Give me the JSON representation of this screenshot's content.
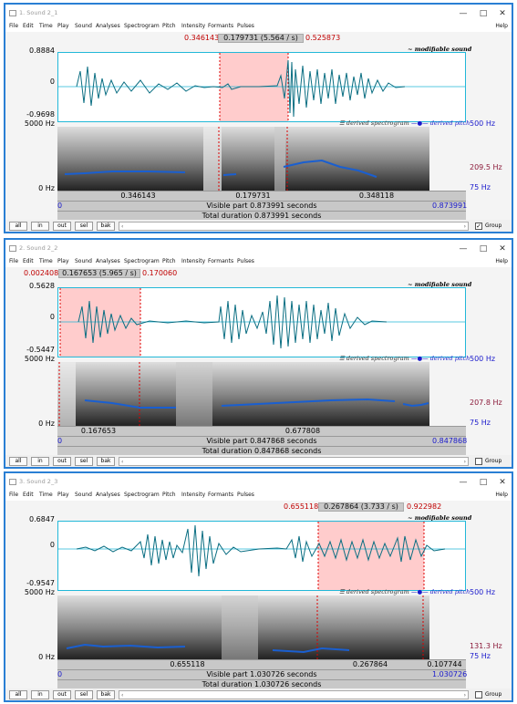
{
  "menu": [
    "File",
    "Edit",
    "Time",
    "Play",
    "Sound",
    "Analyses",
    "Spectrogram",
    "Pitch",
    "Intensity",
    "Formants",
    "Pulses"
  ],
  "help": "Help",
  "legend_modifiable": "~ modifiable sound",
  "legend_spectrogram": "derived spectrogram",
  "legend_pitch": "derived pitch",
  "buttons": [
    "all",
    "in",
    "out",
    "sel",
    "bak"
  ],
  "group_label": "Group",
  "windows": [
    {
      "title": "1. Sound 2_1",
      "sel_left": "0.346143",
      "sel_center": "0.179731 (5.564 / s)",
      "sel_right": "0.525873",
      "y_max": "0.8884",
      "y_zero": "0",
      "y_min": "-0.9698",
      "spec_top": "5000 Hz",
      "spec_bottom": "0 Hz",
      "pitch_top": "500 Hz",
      "pitch_value": "209.5 Hz",
      "pitch_bottom": "75 Hz",
      "seg1": "0.346143",
      "seg2": "0.179731",
      "seg3": "0.348118",
      "vis_left": "0",
      "visible": "Visible part 0.873991 seconds",
      "vis_right": "0.873991",
      "total": "Total duration 0.873991 seconds",
      "group_checked": true
    },
    {
      "title": "2. Sound 2_2",
      "sel_left": "0.002408",
      "sel_center": "0.167653 (5.965 / s)",
      "sel_right": "0.170060",
      "y_max": "0.5628",
      "y_zero": "0",
      "y_min": "-0.5447",
      "spec_top": "5000 Hz",
      "spec_bottom": "0 Hz",
      "pitch_top": "500 Hz",
      "pitch_value": "207.8 Hz",
      "pitch_bottom": "75 Hz",
      "seg1": "0.167653",
      "seg2": "0.677808",
      "seg3": "",
      "vis_left": "0",
      "visible": "Visible part 0.847868 seconds",
      "vis_right": "0.847868",
      "total": "Total duration 0.847868 seconds",
      "group_checked": false
    },
    {
      "title": "3. Sound 2_3",
      "sel_left": "0.655118",
      "sel_center": "0.267864 (3.733 / s)",
      "sel_right": "0.922982",
      "y_max": "0.6847",
      "y_zero": "0",
      "y_min": "-0.9547",
      "spec_top": "5000 Hz",
      "spec_bottom": "0 Hz",
      "pitch_top": "500 Hz",
      "pitch_value": "131.3 Hz",
      "pitch_bottom": "75 Hz",
      "seg1": "0.655118",
      "seg2": "0.267864",
      "seg3": "0.107744",
      "vis_left": "0",
      "visible": "Visible part 1.030726 seconds",
      "vis_right": "1.030726",
      "total": "Total duration 1.030726 seconds",
      "group_checked": false
    }
  ]
}
